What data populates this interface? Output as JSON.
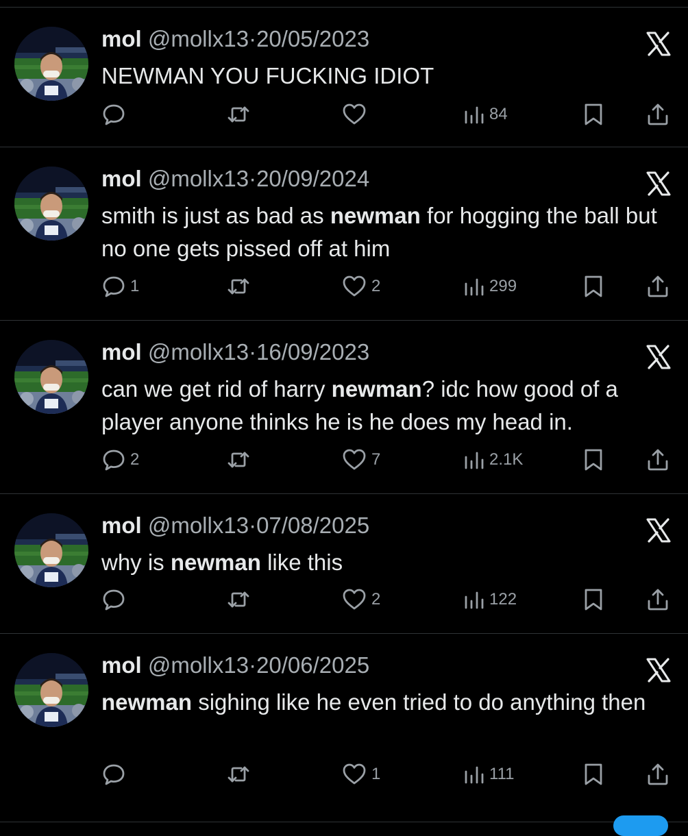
{
  "tweets": [
    {
      "name": "mol",
      "handle": "@mollx13",
      "separator": "·",
      "date": "20/05/2023",
      "segments": [
        {
          "text": "NEWMAN",
          "bold": false
        },
        {
          "text": " YOU FUCKING IDIOT",
          "bold": false
        }
      ],
      "replies": "",
      "retweets": "",
      "likes": "",
      "views": "84"
    },
    {
      "name": "mol",
      "handle": "@mollx13",
      "separator": "·",
      "date": "20/09/2024",
      "segments": [
        {
          "text": "smith is just as bad as ",
          "bold": false
        },
        {
          "text": "newman",
          "bold": true
        },
        {
          "text": " for hogging the ball but no one gets pissed off at him",
          "bold": false
        }
      ],
      "replies": "1",
      "retweets": "",
      "likes": "2",
      "views": "299"
    },
    {
      "name": "mol",
      "handle": "@mollx13",
      "separator": "·",
      "date": "16/09/2023",
      "segments": [
        {
          "text": "can we get rid of harry ",
          "bold": false
        },
        {
          "text": "newman",
          "bold": true
        },
        {
          "text": "? idc how good of a player anyone thinks he is he does my head in.",
          "bold": false
        }
      ],
      "replies": "2",
      "retweets": "",
      "likes": "7",
      "views": "2.1K"
    },
    {
      "name": "mol",
      "handle": "@mollx13",
      "separator": "·",
      "date": "07/08/2025",
      "segments": [
        {
          "text": "why is ",
          "bold": false
        },
        {
          "text": "newman",
          "bold": true
        },
        {
          "text": " like this",
          "bold": false
        }
      ],
      "replies": "",
      "retweets": "",
      "likes": "2",
      "views": "122"
    },
    {
      "name": "mol",
      "handle": "@mollx13",
      "separator": "·",
      "date": "20/06/2025",
      "segments": [
        {
          "text": "newman",
          "bold": true
        },
        {
          "text": " sighing like he even tried to do anything then",
          "bold": false
        }
      ],
      "replies": "",
      "retweets": "",
      "likes": "1",
      "views": "111"
    }
  ],
  "icons": {
    "reply": "reply-icon",
    "retweet": "retweet-icon",
    "like": "heart-icon",
    "views": "views-icon",
    "bookmark": "bookmark-icon",
    "share": "share-icon",
    "platform": "x-logo-icon"
  },
  "colors": {
    "background": "#000000",
    "text": "#e7e9ea",
    "muted": "#a8aeb3",
    "divider": "#2f3336"
  }
}
